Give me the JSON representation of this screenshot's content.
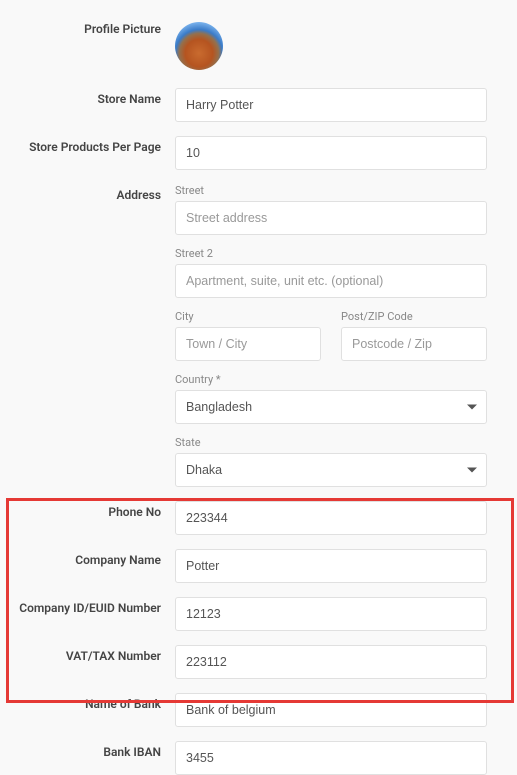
{
  "labels": {
    "profile_picture": "Profile Picture",
    "store_name": "Store Name",
    "per_page": "Store Products Per Page",
    "address": "Address",
    "phone": "Phone No",
    "company_name": "Company Name",
    "company_id": "Company ID/EUID Number",
    "vat": "VAT/TAX Number",
    "bank_name": "Name of Bank",
    "iban": "Bank IBAN"
  },
  "address": {
    "street_label": "Street",
    "street_placeholder": "Street address",
    "street2_label": "Street 2",
    "street2_placeholder": "Apartment, suite, unit etc. (optional)",
    "city_label": "City",
    "city_placeholder": "Town / City",
    "zip_label": "Post/ZIP Code",
    "zip_placeholder": "Postcode / Zip",
    "country_label": "Country *",
    "country_value": "Bangladesh",
    "state_label": "State",
    "state_value": "Dhaka"
  },
  "values": {
    "store_name": "Harry Potter",
    "per_page": "10",
    "phone": "223344",
    "company_name": "Potter",
    "company_id": "12123",
    "vat": "223112",
    "bank_name": "Bank of belgium",
    "iban": "3455"
  }
}
